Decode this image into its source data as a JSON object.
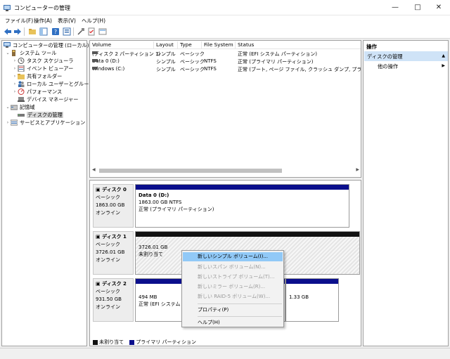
{
  "window": {
    "title": "コンピューターの管理"
  },
  "menu": [
    "ファイル(F)",
    "操作(A)",
    "表示(V)",
    "ヘルプ(H)"
  ],
  "tree": {
    "root": "コンピューターの管理 (ローカル)",
    "system_tools": "システム ツール",
    "task_scheduler": "タスク スケジューラ",
    "event_viewer": "イベント ビューアー",
    "shared_folders": "共有フォルダー",
    "local_users": "ローカル ユーザーとグループ",
    "performance": "パフォーマンス",
    "device_manager": "デバイス マネージャー",
    "storage": "記憶域",
    "disk_management": "ディスクの管理",
    "services_apps": "サービスとアプリケーション"
  },
  "volumes": {
    "headers": [
      "Volume",
      "Layout",
      "Type",
      "File System",
      "Status"
    ],
    "rows": [
      [
        "(ディスク 2 パーティション 1)",
        "シンプル",
        "ベーシック",
        "",
        "正常 (EFI システム パーティション)"
      ],
      [
        "Data 0 (D:)",
        "シンプル",
        "ベーシック",
        "NTFS",
        "正常 (プライマリ パーティション)"
      ],
      [
        "Windows (C:)",
        "シンプル",
        "ベーシック",
        "NTFS",
        "正常 (ブート, ページ ファイル, クラッシュ ダンプ, プライマリ パ-"
      ]
    ]
  },
  "disks": [
    {
      "name": "ディスク 0",
      "type": "ベーシック",
      "size": "1863.00 GB",
      "state": "オンライン",
      "volume_name": "Data 0  (D:)",
      "volume_size": "1863.00 GB NTFS",
      "volume_status": "正常 (プライマリ パーティション)"
    },
    {
      "name": "ディスク 1",
      "type": "ベーシック",
      "size": "3726.01 GB",
      "state": "オンライン",
      "volume_size": "3726.01 GB",
      "volume_status": "未割り当て"
    },
    {
      "name": "ディスク 2",
      "type": "ベーシック",
      "size": "931.50 GB",
      "state": "オンライン",
      "part1_size": "494 MB",
      "part1_status": "正常 (EFI システム",
      "part3_size": "1.33 GB"
    }
  ],
  "legend": {
    "unallocated": "未割り当て",
    "primary": "プライマリ パーティション"
  },
  "actions": {
    "header": "操作",
    "selected": "ディスクの管理",
    "other": "他の操作"
  },
  "context_menu": [
    "新しいシンプル ボリューム(I)...",
    "新しいスパン ボリューム(N)...",
    "新しいストライプ ボリューム(T)...",
    "新しいミラー ボリューム(R)...",
    "新しい RAID-5 ボリューム(W)...",
    "プロパティ(P)",
    "ヘルプ(H)"
  ],
  "colors": {
    "primary_partition": "#0b0f8c",
    "unallocated": "#111111",
    "highlight": "#91c9f7",
    "selected_action": "#cfe3f7"
  }
}
